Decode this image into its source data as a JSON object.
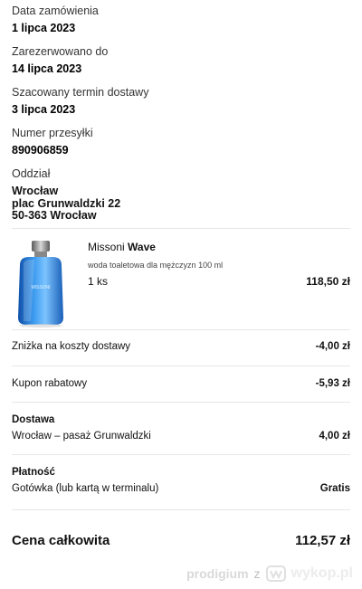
{
  "order": {
    "date_label": "Data zamówienia",
    "date_value": "1 lipca 2023",
    "reserved_label": "Zarezerwowano do",
    "reserved_value": "14 lipca 2023",
    "delivery_est_label": "Szacowany termin dostawy",
    "delivery_est_value": "3 lipca 2023",
    "tracking_label": "Numer przesyłki",
    "tracking_value": "890906859",
    "branch_label": "Oddział",
    "branch_lines": [
      "Wrocław",
      "plac Grunwaldzki 22",
      "50-363 Wrocław"
    ]
  },
  "product": {
    "brand": "Missoni",
    "name": "Wave",
    "description": "woda toaletowa dla mężczyzn 100 ml",
    "quantity": "1 ks",
    "price": "118,50 zł",
    "bottle_color": "#2a7fd6"
  },
  "rows": {
    "shipping_discount_label": "Zniżka na koszty dostawy",
    "shipping_discount_value": "-4,00 zł",
    "coupon_label": "Kupon rabatowy",
    "coupon_value": "-5,93 zł",
    "delivery_title": "Dostawa",
    "delivery_place": "Wrocław – pasaż Grunwaldzki",
    "delivery_cost": "4,00 zł",
    "payment_title": "Płatność",
    "payment_method": "Gotówka (lub kartą w terminalu)",
    "payment_cost": "Gratis"
  },
  "total": {
    "label": "Cena całkowita",
    "value": "112,57 zł"
  },
  "watermark": {
    "user": "prodigium",
    "z": "z",
    "site": "wykop.pl"
  }
}
